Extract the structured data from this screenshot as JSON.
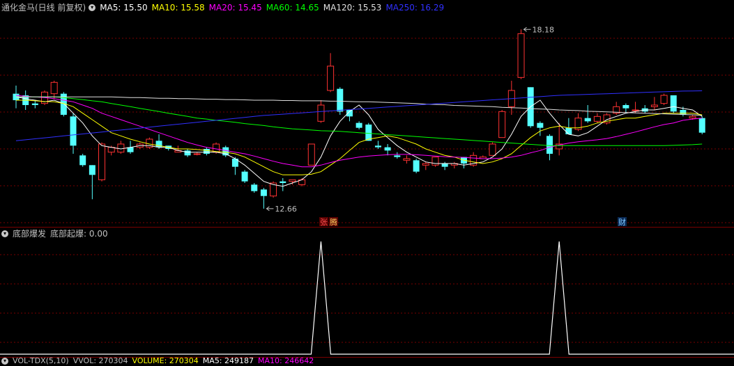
{
  "header": {
    "stock_label": "通化金马(日线 前复权)",
    "ma": [
      {
        "label": "MA5: 15.50",
        "color": "#ffffff"
      },
      {
        "label": "MA10: 15.58",
        "color": "#ffff00"
      },
      {
        "label": "MA20: 15.45",
        "color": "#ff00ff"
      },
      {
        "label": "MA60: 14.65",
        "color": "#00ff00"
      },
      {
        "label": "MA120: 15.53",
        "color": "#e0e0e0"
      },
      {
        "label": "MA250: 16.29",
        "color": "#3030ff"
      }
    ]
  },
  "indicator_header": {
    "name": "底部爆发",
    "value": "底部起爆: 0.00"
  },
  "volume_header": {
    "name": "VOL-TDX(5,10)",
    "items": [
      {
        "label": "VVOL: 270304",
        "color": "#c0c0c0"
      },
      {
        "label": "VOLUME: 270304",
        "color": "#ffff00"
      },
      {
        "label": "MA5: 249187",
        "color": "#ffffff"
      },
      {
        "label": "MA10: 246642",
        "color": "#ff00ff"
      }
    ]
  },
  "annotations": {
    "high": "18.18",
    "low": "12.66",
    "tag1a": "张",
    "tag1b": "腾",
    "tag2": "财"
  },
  "colors": {
    "up": "#ff3232",
    "down": "#54ffff",
    "grid": "#7a0000"
  },
  "chart_data": {
    "type": "candlestick",
    "price_range": [
      12.1,
      18.7
    ],
    "candles": [
      [
        16.2,
        16.0,
        16.45,
        15.75
      ],
      [
        16.15,
        15.85,
        16.3,
        15.7
      ],
      [
        15.9,
        15.85,
        16.0,
        15.75
      ],
      [
        15.9,
        16.25,
        16.3,
        15.85
      ],
      [
        16.2,
        16.55,
        16.6,
        16.05
      ],
      [
        16.2,
        15.55,
        16.25,
        15.5
      ],
      [
        15.5,
        14.6,
        15.6,
        14.35
      ],
      [
        14.3,
        14.0,
        14.35,
        13.95
      ],
      [
        14.0,
        13.7,
        14.0,
        12.95
      ],
      [
        13.55,
        14.65,
        14.7,
        13.5
      ],
      [
        14.4,
        14.55,
        14.6,
        14.3
      ],
      [
        14.4,
        14.65,
        14.75,
        14.35
      ],
      [
        14.55,
        14.4,
        14.75,
        14.35
      ],
      [
        14.55,
        14.65,
        14.7,
        14.5
      ],
      [
        14.55,
        14.8,
        14.85,
        14.5
      ],
      [
        14.75,
        14.55,
        14.95,
        14.5
      ],
      [
        14.6,
        14.5,
        14.6,
        14.45
      ],
      [
        14.4,
        14.45,
        14.6,
        14.4
      ],
      [
        14.45,
        14.3,
        14.5,
        14.25
      ],
      [
        14.35,
        14.35,
        14.4,
        14.3
      ],
      [
        14.5,
        14.35,
        14.55,
        14.3
      ],
      [
        14.4,
        14.65,
        14.7,
        14.35
      ],
      [
        14.55,
        14.3,
        14.6,
        14.25
      ],
      [
        14.2,
        13.95,
        14.25,
        13.7
      ],
      [
        13.8,
        13.5,
        13.85,
        13.45
      ],
      [
        13.4,
        13.2,
        13.45,
        13.15
      ],
      [
        13.25,
        13.05,
        13.3,
        12.66
      ],
      [
        13.05,
        13.45,
        13.5,
        13.0
      ],
      [
        13.5,
        13.45,
        13.6,
        13.2
      ],
      [
        13.5,
        13.55,
        13.55,
        13.4
      ],
      [
        13.4,
        13.55,
        13.6,
        13.35
      ],
      [
        14.0,
        14.65,
        14.65,
        14.0
      ],
      [
        15.35,
        15.85,
        16.0,
        15.3
      ],
      [
        16.3,
        17.05,
        17.45,
        16.25
      ],
      [
        16.35,
        15.65,
        16.4,
        15.55
      ],
      [
        15.7,
        15.5,
        15.7,
        15.35
      ],
      [
        15.3,
        15.15,
        15.35,
        15.1
      ],
      [
        15.25,
        14.75,
        15.3,
        14.75
      ],
      [
        14.6,
        14.55,
        14.75,
        14.5
      ],
      [
        14.55,
        14.45,
        14.65,
        14.3
      ],
      [
        14.3,
        14.25,
        14.4,
        14.2
      ],
      [
        14.15,
        14.2,
        14.3,
        14.05
      ],
      [
        14.15,
        13.8,
        14.2,
        13.75
      ],
      [
        14.0,
        14.05,
        14.1,
        13.85
      ],
      [
        14.0,
        14.25,
        14.25,
        13.95
      ],
      [
        14.05,
        13.95,
        14.1,
        13.85
      ],
      [
        14.0,
        14.05,
        14.1,
        13.9
      ],
      [
        14.25,
        14.05,
        14.25,
        13.9
      ],
      [
        14.0,
        14.3,
        14.4,
        13.95
      ],
      [
        14.2,
        14.25,
        14.3,
        14.2
      ],
      [
        14.3,
        14.65,
        14.7,
        14.3
      ],
      [
        14.85,
        15.65,
        15.7,
        14.85
      ],
      [
        15.8,
        16.3,
        16.6,
        15.55
      ],
      [
        16.7,
        18.05,
        18.18,
        16.65
      ],
      [
        16.4,
        15.2,
        16.4,
        15.15
      ],
      [
        15.3,
        15.15,
        15.35,
        14.9
      ],
      [
        14.9,
        14.35,
        14.95,
        14.15
      ],
      [
        14.5,
        14.65,
        15.3,
        14.3
      ],
      [
        15.15,
        14.95,
        15.45,
        14.95
      ],
      [
        15.1,
        15.45,
        15.6,
        15.05
      ],
      [
        15.45,
        15.35,
        15.85,
        15.3
      ],
      [
        15.35,
        15.5,
        15.6,
        15.3
      ],
      [
        15.3,
        15.55,
        15.6,
        15.25
      ],
      [
        15.6,
        15.8,
        15.95,
        15.55
      ],
      [
        15.85,
        15.75,
        15.9,
        15.6
      ],
      [
        15.7,
        15.7,
        15.95,
        15.6
      ],
      [
        15.75,
        15.65,
        15.85,
        15.6
      ],
      [
        15.8,
        15.85,
        16.1,
        15.7
      ],
      [
        15.9,
        16.15,
        16.2,
        15.85
      ],
      [
        16.15,
        15.65,
        16.15,
        15.6
      ],
      [
        15.7,
        15.55,
        15.8,
        15.5
      ],
      [
        15.45,
        15.5,
        15.55,
        15.4
      ],
      [
        15.45,
        15.0,
        15.5,
        14.95
      ]
    ],
    "ma5": [
      16.1,
      16.05,
      16.0,
      15.95,
      16.0,
      15.9,
      15.6,
      15.3,
      14.9,
      14.6,
      14.55,
      14.5,
      14.55,
      14.6,
      14.6,
      14.55,
      14.55,
      14.45,
      14.4,
      14.4,
      14.4,
      14.4,
      14.35,
      14.2,
      14.0,
      13.75,
      13.5,
      13.4,
      13.35,
      13.45,
      13.55,
      13.8,
      14.25,
      14.9,
      15.35,
      15.65,
      15.85,
      15.55,
      15.1,
      14.85,
      14.6,
      14.4,
      14.25,
      14.1,
      14.05,
      14.05,
      14.05,
      14.0,
      14.05,
      14.1,
      14.25,
      14.5,
      14.95,
      15.5,
      15.8,
      16.0,
      15.6,
      15.25,
      14.95,
      14.9,
      15.0,
      15.2,
      15.4,
      15.5,
      15.6,
      15.65,
      15.7,
      15.7,
      15.75,
      15.8,
      15.75,
      15.7,
      15.5
    ],
    "ma10": [
      16.0,
      16.0,
      15.98,
      15.96,
      15.95,
      15.9,
      15.8,
      15.6,
      15.4,
      15.2,
      15.0,
      14.9,
      14.8,
      14.72,
      14.65,
      14.6,
      14.55,
      14.5,
      14.5,
      14.48,
      14.45,
      14.42,
      14.4,
      14.35,
      14.25,
      14.1,
      13.95,
      13.8,
      13.7,
      13.7,
      13.7,
      13.72,
      13.8,
      14.0,
      14.2,
      14.45,
      14.7,
      14.8,
      14.85,
      14.9,
      14.85,
      14.75,
      14.65,
      14.5,
      14.4,
      14.3,
      14.25,
      14.15,
      14.1,
      14.05,
      14.1,
      14.2,
      14.35,
      14.6,
      14.85,
      15.05,
      15.15,
      15.2,
      15.15,
      15.15,
      15.2,
      15.3,
      15.35,
      15.4,
      15.45,
      15.45,
      15.5,
      15.55,
      15.6,
      15.6,
      15.6,
      15.6,
      15.55
    ],
    "ma20": [
      16.15,
      16.12,
      16.1,
      16.08,
      16.05,
      16.0,
      15.95,
      15.85,
      15.75,
      15.6,
      15.5,
      15.4,
      15.3,
      15.2,
      15.1,
      15.0,
      14.9,
      14.8,
      14.7,
      14.62,
      14.55,
      14.5,
      14.45,
      14.4,
      14.35,
      14.28,
      14.2,
      14.12,
      14.05,
      14.0,
      13.95,
      13.95,
      14.0,
      14.08,
      14.15,
      14.2,
      14.25,
      14.28,
      14.3,
      14.32,
      14.33,
      14.33,
      14.32,
      14.3,
      14.28,
      14.26,
      14.25,
      14.24,
      14.22,
      14.2,
      14.2,
      14.22,
      14.25,
      14.3,
      14.38,
      14.45,
      14.55,
      14.62,
      14.68,
      14.72,
      14.75,
      14.78,
      14.82,
      14.88,
      14.95,
      15.02,
      15.1,
      15.18,
      15.25,
      15.3,
      15.38,
      15.42,
      15.45
    ],
    "ma60": [
      16.1,
      16.1,
      16.1,
      16.1,
      16.1,
      16.08,
      16.05,
      16.02,
      15.98,
      15.95,
      15.9,
      15.85,
      15.8,
      15.75,
      15.7,
      15.65,
      15.6,
      15.55,
      15.5,
      15.45,
      15.42,
      15.38,
      15.35,
      15.32,
      15.28,
      15.25,
      15.22,
      15.18,
      15.15,
      15.12,
      15.1,
      15.08,
      15.06,
      15.05,
      15.04,
      15.02,
      15.0,
      14.98,
      14.96,
      14.94,
      14.92,
      14.9,
      14.88,
      14.86,
      14.84,
      14.82,
      14.8,
      14.78,
      14.76,
      14.74,
      14.72,
      14.7,
      14.68,
      14.66,
      14.64,
      14.62,
      14.6,
      14.6,
      14.6,
      14.6,
      14.6,
      14.6,
      14.6,
      14.6,
      14.6,
      14.6,
      14.6,
      14.6,
      14.6,
      14.61,
      14.62,
      14.63,
      14.65
    ],
    "ma120": [
      16.1,
      16.1,
      16.1,
      16.1,
      16.1,
      16.1,
      16.1,
      16.1,
      16.1,
      16.1,
      16.1,
      16.09,
      16.08,
      16.08,
      16.07,
      16.06,
      16.06,
      16.05,
      16.05,
      16.04,
      16.03,
      16.03,
      16.02,
      16.02,
      16.01,
      16.0,
      16.0,
      16.0,
      15.99,
      15.99,
      15.98,
      15.98,
      15.98,
      15.97,
      15.97,
      15.96,
      15.95,
      15.95,
      15.94,
      15.93,
      15.92,
      15.91,
      15.9,
      15.88,
      15.87,
      15.86,
      15.84,
      15.83,
      15.82,
      15.81,
      15.8,
      15.78,
      15.77,
      15.76,
      15.74,
      15.73,
      15.72,
      15.7,
      15.69,
      15.68,
      15.66,
      15.65,
      15.64,
      15.63,
      15.62,
      15.61,
      15.6,
      15.59,
      15.58,
      15.57,
      15.56,
      15.55,
      15.53
    ],
    "ma250": [
      14.75,
      14.78,
      14.81,
      14.84,
      14.87,
      14.9,
      14.93,
      14.96,
      14.99,
      15.02,
      15.05,
      15.08,
      15.11,
      15.14,
      15.17,
      15.2,
      15.23,
      15.26,
      15.29,
      15.32,
      15.35,
      15.38,
      15.41,
      15.44,
      15.47,
      15.5,
      15.53,
      15.55,
      15.57,
      15.59,
      15.61,
      15.63,
      15.65,
      15.67,
      15.69,
      15.71,
      15.73,
      15.75,
      15.77,
      15.79,
      15.81,
      15.83,
      15.85,
      15.87,
      15.89,
      15.91,
      15.93,
      15.95,
      15.97,
      15.99,
      16.01,
      16.03,
      16.05,
      16.07,
      16.09,
      16.11,
      16.13,
      16.15,
      16.16,
      16.17,
      16.18,
      16.19,
      16.2,
      16.21,
      16.22,
      16.23,
      16.24,
      16.25,
      16.26,
      16.27,
      16.28,
      16.285,
      16.29
    ],
    "signal": [
      0,
      0,
      0,
      0,
      0,
      0,
      0,
      0,
      0,
      0,
      0,
      0,
      0,
      0,
      0,
      0,
      0,
      0,
      0,
      0,
      0,
      0,
      0,
      0,
      0,
      0,
      0,
      0,
      0,
      0,
      0,
      0,
      1,
      0,
      0,
      0,
      0,
      0,
      0,
      0,
      0,
      0,
      0,
      0,
      0,
      0,
      0,
      0,
      0,
      0,
      0,
      0,
      0,
      0,
      0,
      0,
      0,
      1,
      0,
      0,
      0,
      0,
      0,
      0,
      0,
      0,
      0,
      0,
      0,
      0,
      0,
      0,
      0
    ]
  }
}
